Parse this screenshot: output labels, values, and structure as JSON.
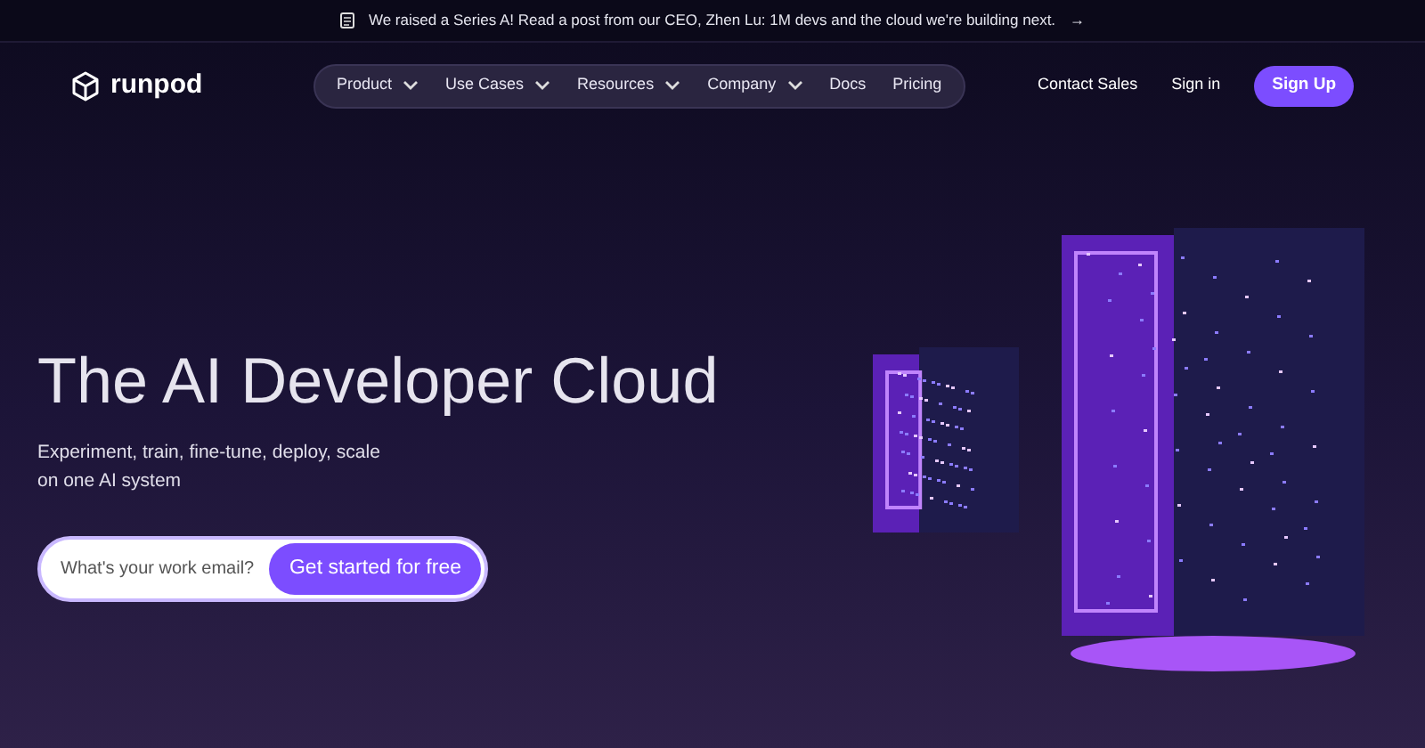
{
  "announcement": {
    "text": "We raised a Series A! Read a post from our CEO, Zhen Lu: 1M devs and the cloud we're building next.",
    "arrow": "→"
  },
  "nav": {
    "logo": "runpod",
    "items": [
      {
        "label": "Product",
        "has_menu": true
      },
      {
        "label": "Use Cases",
        "has_menu": true
      },
      {
        "label": "Resources",
        "has_menu": true
      },
      {
        "label": "Company",
        "has_menu": true
      },
      {
        "label": "Docs",
        "has_menu": false
      },
      {
        "label": "Pricing",
        "has_menu": false
      }
    ],
    "actions": [
      "Contact Sales",
      "Sign in"
    ],
    "cta": "Sign Up"
  },
  "hero": {
    "title": "The AI Developer Cloud",
    "subtitle_lines": [
      "Experiment, train, fine-tune, deploy, scale",
      "on one AI system"
    ],
    "email_placeholder": "What's your work email?",
    "submit": "Get started for free"
  }
}
